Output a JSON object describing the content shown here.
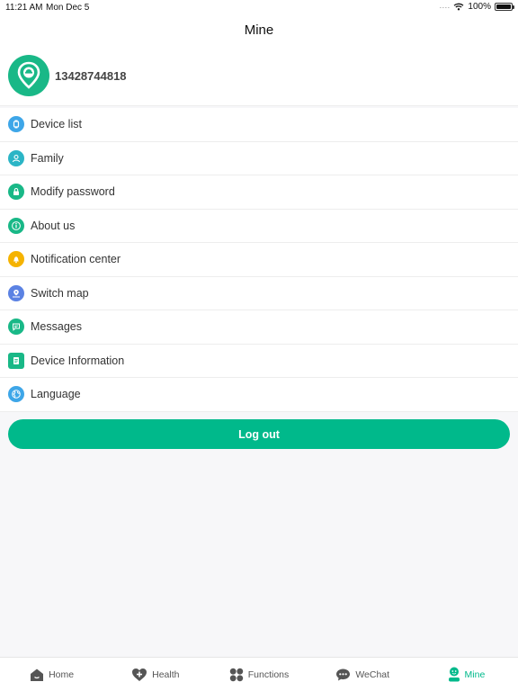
{
  "status": {
    "time": "11:21 AM",
    "date": "Mon Dec 5",
    "battery": "100%"
  },
  "header": {
    "title": "Mine"
  },
  "profile": {
    "phone": "13428744818"
  },
  "menu": [
    {
      "label": "Device list",
      "icon": "watch-icon",
      "color": "#3ea6e8"
    },
    {
      "label": "Family",
      "icon": "person-icon",
      "color": "#2bb5c6"
    },
    {
      "label": "Modify password",
      "icon": "lock-icon",
      "color": "#19b887"
    },
    {
      "label": "About us",
      "icon": "info-icon",
      "color": "#19b887"
    },
    {
      "label": "Notification center",
      "icon": "bell-icon",
      "color": "#f5b301"
    },
    {
      "label": "Switch map",
      "icon": "map-icon",
      "color": "#5b82e3"
    },
    {
      "label": "Messages",
      "icon": "message-icon",
      "color": "#19b887"
    },
    {
      "label": "Device Information",
      "icon": "document-icon",
      "color": "#19b887"
    },
    {
      "label": "Language",
      "icon": "globe-icon",
      "color": "#3ea6e8"
    }
  ],
  "logout": {
    "label": "Log out"
  },
  "tabs": [
    {
      "label": "Home",
      "icon": "home-icon"
    },
    {
      "label": "Health",
      "icon": "heart-plus-icon"
    },
    {
      "label": "Functions",
      "icon": "grid-icon"
    },
    {
      "label": "WeChat",
      "icon": "chat-icon"
    },
    {
      "label": "Mine",
      "icon": "user-icon",
      "active": true
    }
  ],
  "colors": {
    "accent": "#00b98b",
    "tab_inactive": "#555555"
  }
}
